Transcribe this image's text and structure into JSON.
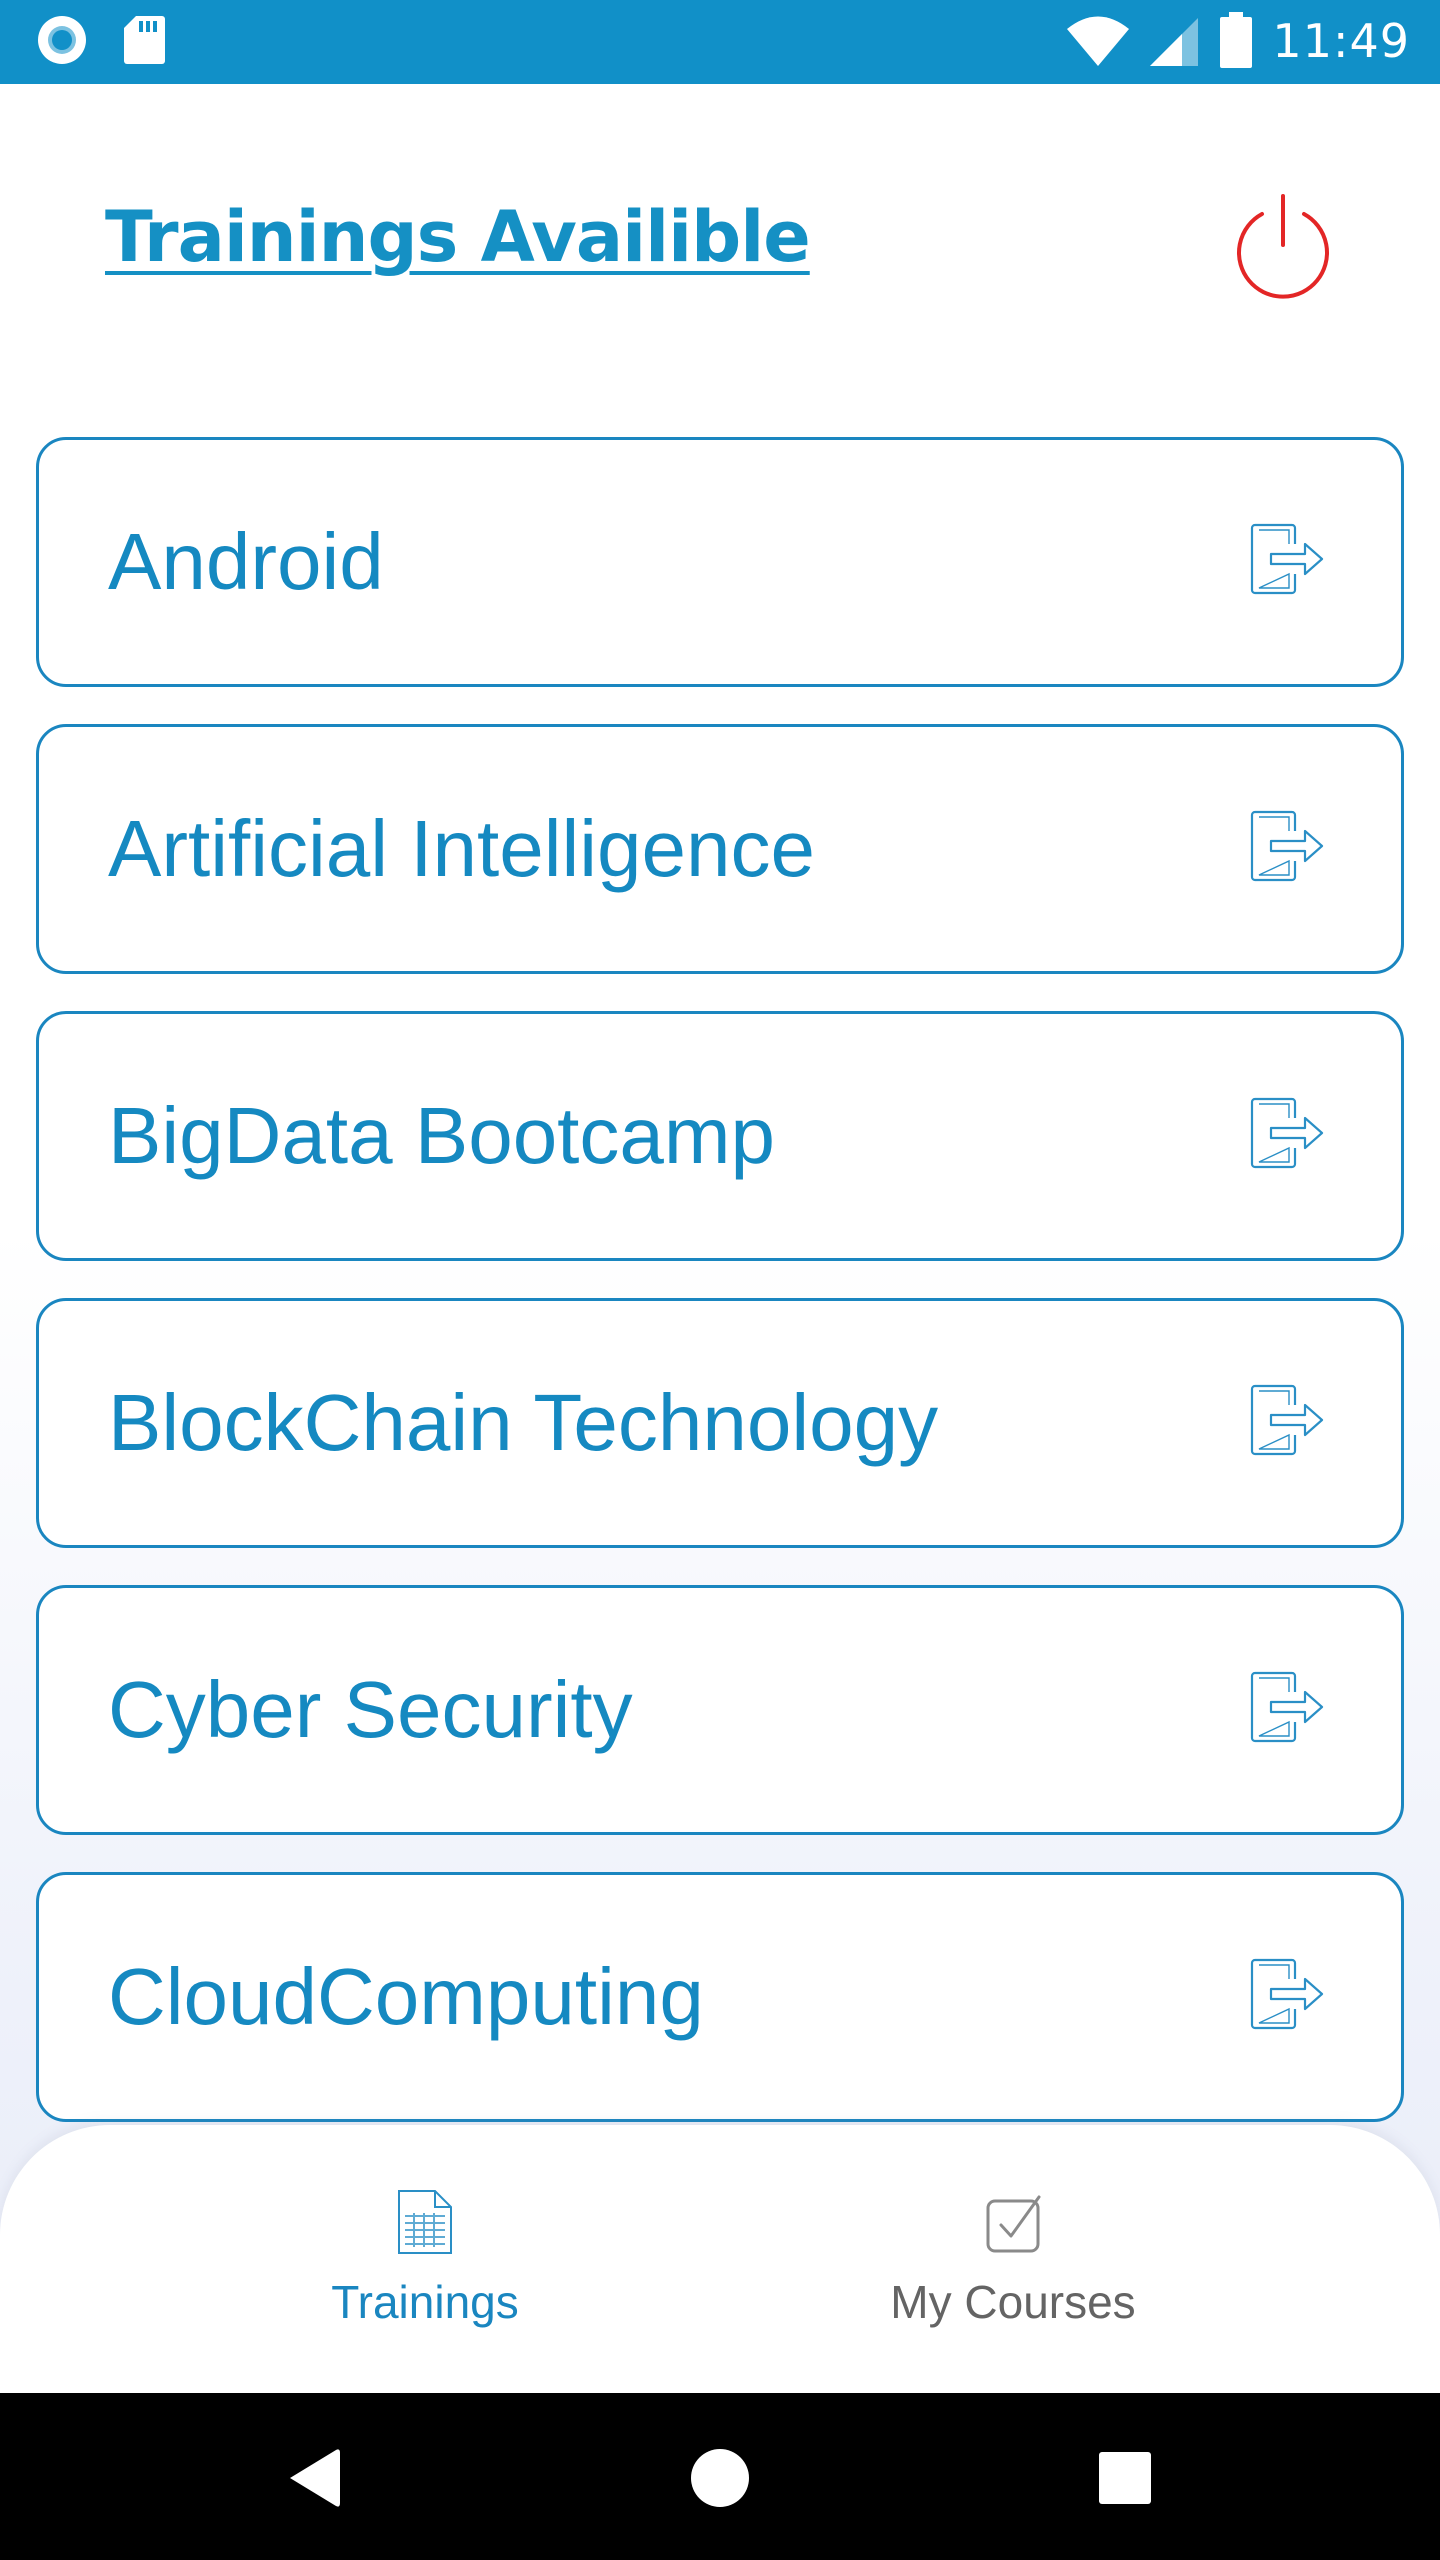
{
  "status_bar": {
    "time": "11:49",
    "left_icons": [
      "camera-notification-icon",
      "sd-card-icon"
    ],
    "right_icons": [
      "wifi-icon",
      "cell-signal-icon",
      "battery-icon"
    ]
  },
  "header": {
    "title": "Trainings Availible",
    "action_icon": "power-icon"
  },
  "courses": [
    {
      "label": "Android",
      "icon": "enter-arrow-icon"
    },
    {
      "label": "Artificial Intelligence",
      "icon": "enter-arrow-icon"
    },
    {
      "label": "BigData Bootcamp",
      "icon": "enter-arrow-icon"
    },
    {
      "label": "BlockChain Technology",
      "icon": "enter-arrow-icon"
    },
    {
      "label": "Cyber Security",
      "icon": "enter-arrow-icon"
    },
    {
      "label": "CloudComputing",
      "icon": "enter-arrow-icon"
    }
  ],
  "bottom_nav": {
    "tabs": [
      {
        "label": "Trainings",
        "icon": "document-icon",
        "active": true
      },
      {
        "label": "My Courses",
        "icon": "checkbox-icon",
        "active": false
      }
    ]
  },
  "system_nav": [
    "back-icon",
    "home-icon",
    "recents-icon"
  ],
  "colors": {
    "status_bar": "#1190c8",
    "accent": "#1590c4",
    "power": "#e32626",
    "inactive_tab": "#646464"
  }
}
